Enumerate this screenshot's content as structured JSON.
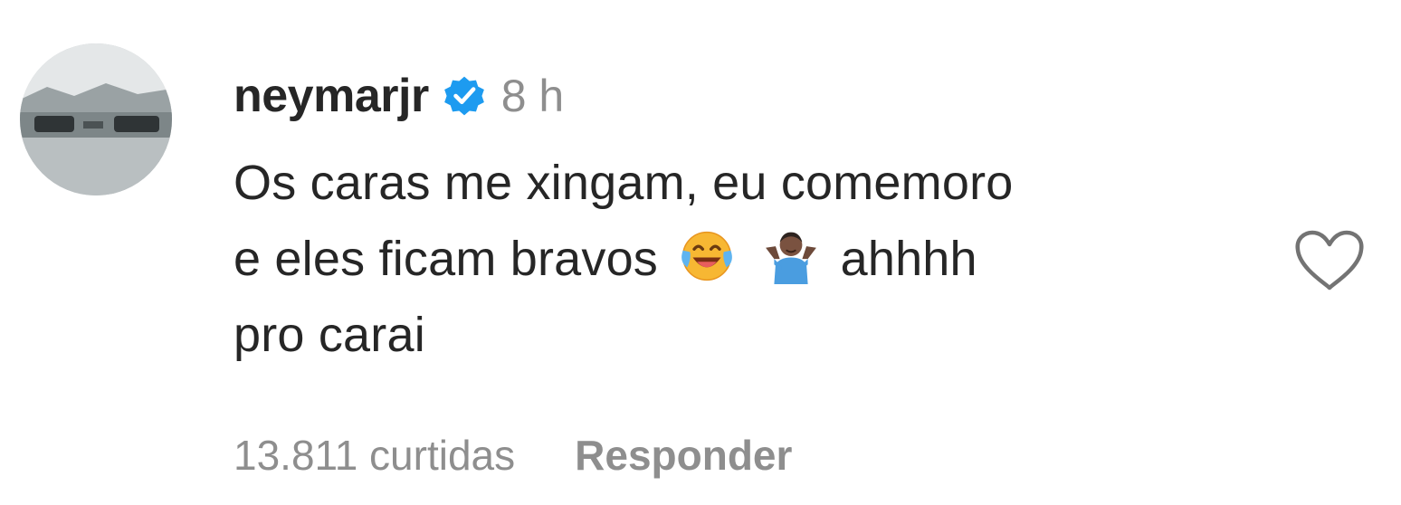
{
  "comment": {
    "avatar_icon": "profile-photo-avatar",
    "username": "neymarjr",
    "verified_icon": "verified-badge-icon",
    "verified_color": "#1d9bf0",
    "time": "8 h",
    "text_line_1": "Os caras me xingam, eu comemoro",
    "text_line_2_start": "e eles ficam bravos",
    "emoji_1": "face-with-tears-of-joy-icon",
    "emoji_2": "person-shrugging-icon",
    "text_line_2_end": "ahhhh",
    "text_line_3": "pro carai",
    "like_icon": "heart-outline-icon",
    "likes": "13.811 curtidas",
    "reply_label": "Responder"
  },
  "colors": {
    "text": "#262626",
    "secondary": "#8e8e8e",
    "background": "#ffffff"
  }
}
